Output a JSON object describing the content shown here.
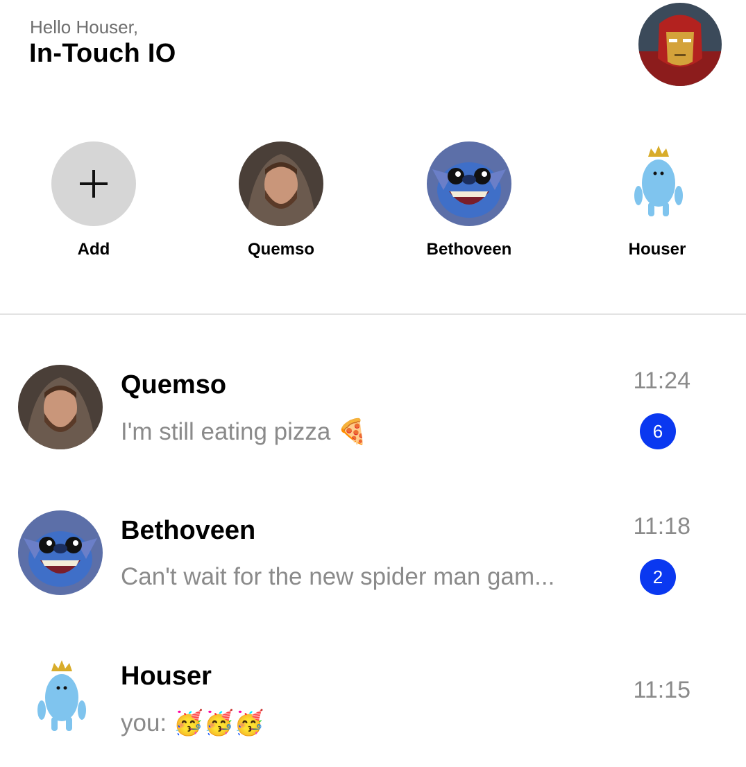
{
  "header": {
    "greeting": "Hello Houser,",
    "app_title": "In-Touch IO"
  },
  "stories": [
    {
      "label": "Add",
      "icon": "plus-icon"
    },
    {
      "label": "Quemso",
      "avatar": "bearded-man-avatar"
    },
    {
      "label": "Bethoveen",
      "avatar": "blue-alien-avatar"
    },
    {
      "label": "Houser",
      "avatar": "blue-bean-crown-avatar"
    }
  ],
  "chats": [
    {
      "name": "Quemso",
      "preview": "I'm still eating pizza 🍕",
      "time": "11:24",
      "unread": "6"
    },
    {
      "name": "Bethoveen",
      "preview": "Can't wait for the new spider man gam...",
      "time": "11:18",
      "unread": "2"
    },
    {
      "name": "Houser",
      "preview": "you: 🥳🥳🥳",
      "time": "11:15",
      "unread": ""
    }
  ],
  "colors": {
    "badge": "#0a38f0",
    "add_circle": "#d6d6d6",
    "muted_text": "#8a8a8a"
  }
}
